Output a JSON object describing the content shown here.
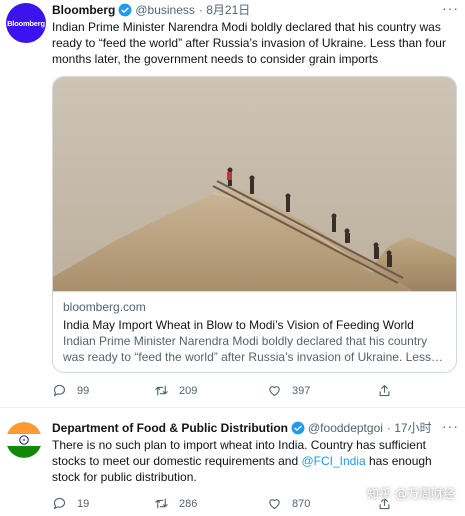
{
  "tweets": [
    {
      "author_name": "Bloomberg",
      "avatar_text": "Bloomberg",
      "handle": "@business",
      "time": "· 8月21日",
      "more": "···",
      "text": "Indian Prime Minister Narendra Modi boldly declared that his country was ready to “feed the world” after Russia’s invasion of Ukraine. Less than four months later, the government needs to consider grain imports",
      "card": {
        "domain": "bloomberg.com",
        "title": "India May Import Wheat in Blow to Modi’s Vision of Feeding World",
        "description": "Indian Prime Minister Narendra Modi boldly declared that his country was ready to “feed the world” after Russia’s invasion of Ukraine. Less…"
      },
      "stats": {
        "replies": "99",
        "retweets": "209",
        "likes": "397"
      }
    },
    {
      "author_name": "Department of Food & Public Distribution",
      "handle": "@fooddeptgoi",
      "time": "· 17小时",
      "more": "···",
      "text_before": "There is no such plan to import wheat into India. Country has sufficient stocks to meet our domestic requirements and ",
      "mention": "@FCI_India",
      "text_after": " has enough stock for public distribution.",
      "stats": {
        "replies": "19",
        "retweets": "286",
        "likes": "870"
      }
    }
  ],
  "watermark": "知乎 @万周财经",
  "colors": {
    "accent": "#1d9bf0",
    "muted": "#536471",
    "text": "#0f1419",
    "bloomberg": "#3c12ee",
    "border": "#cfd9de"
  },
  "icons": [
    "verified-badge-icon",
    "more-icon",
    "reply-icon",
    "retweet-icon",
    "like-icon",
    "share-icon",
    "india-flag-avatar"
  ]
}
